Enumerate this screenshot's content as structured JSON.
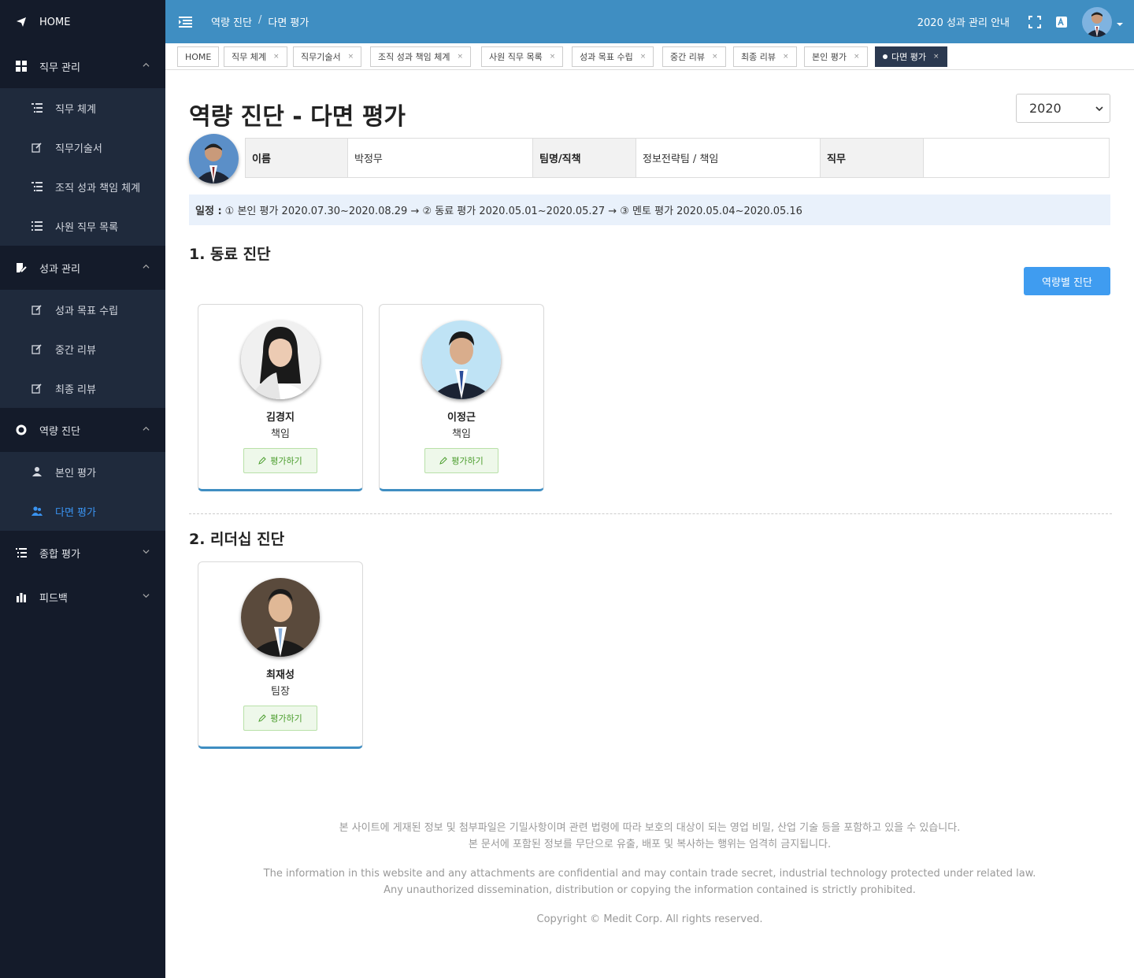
{
  "sidebar": {
    "home_label": "HOME",
    "groups": [
      {
        "label": "직무 관리",
        "items": [
          "직무 체계",
          "직무기술서",
          "조직 성과 책임 체계",
          "사원 직무 목록"
        ]
      },
      {
        "label": "성과 관리",
        "items": [
          "성과 목표 수립",
          "중간 리뷰",
          "최종 리뷰"
        ]
      },
      {
        "label": "역량 진단",
        "items": [
          "본인 평가",
          "다면 평가"
        ]
      },
      {
        "label": "종합 평가",
        "items": []
      },
      {
        "label": "피드백",
        "items": []
      }
    ]
  },
  "topbar": {
    "breadcrumb": [
      "역량 진단",
      "다면 평가"
    ],
    "breadcrumb_sep": "/",
    "guide_label": "2020 성과 관리 안내"
  },
  "tabs": [
    "HOME",
    "직무 체계",
    "직무기술서",
    "조직 성과 책임 체계",
    "사원 직무 목록",
    "성과 목표 수립",
    "중간 리뷰",
    "최종 리뷰",
    "본인 평가",
    "다면 평가"
  ],
  "tab_close": "×",
  "main": {
    "title": "역량 진단 - 다면 평가",
    "year": "2020",
    "info": {
      "name_label": "이름",
      "name_value": "박정무",
      "team_label": "팀명/직책",
      "team_value": "정보전략팀 / 책임",
      "job_label": "직무",
      "job_value": ""
    },
    "schedule": {
      "label": "일정 :",
      "text": "① 본인 평가 2020.07.30~2020.08.29 → ② 동료 평가 2020.05.01~2020.05.27 → ③ 멘토 평가 2020.05.04~2020.05.16"
    },
    "section1_title": "1. 동료 진단",
    "capability_button": "역량별 진단",
    "peers": [
      {
        "name": "김경지",
        "rank": "책임",
        "button": "평가하기"
      },
      {
        "name": "이정근",
        "rank": "책임",
        "button": "평가하기"
      }
    ],
    "section2_title": "2. 리더십 진단",
    "leaders": [
      {
        "name": "최재성",
        "rank": "팀장",
        "button": "평가하기"
      }
    ]
  },
  "footer": {
    "ko_line1": "본 사이트에 게재된 정보 및 첨부파일은 기밀사항이며 관련 법령에 따라 보호의 대상이 되는 영업 비밀, 산업 기술 등을 포함하고 있을 수 있습니다.",
    "ko_line2": "본 문서에 포함된 정보를 무단으로 유출, 배포 및 복사하는 행위는 엄격히 금지됩니다.",
    "en_line1": "The information in this website and any attachments are confidential and may contain trade secret, industrial technology protected under related law.",
    "en_line2": "Any unauthorized dissemination, distribution or copying the information contained is strictly prohibited.",
    "copyright": "Copyright © Medit Corp. All rights reserved."
  },
  "colors": {
    "sidebar_bg": "#141b2a",
    "sidebar_sub_bg": "#1f2a3c",
    "topbar": "#3f8ec2",
    "accent": "#3f9cf0",
    "active_tab": "#2b3950",
    "eval_green": "#4a9d2c"
  }
}
